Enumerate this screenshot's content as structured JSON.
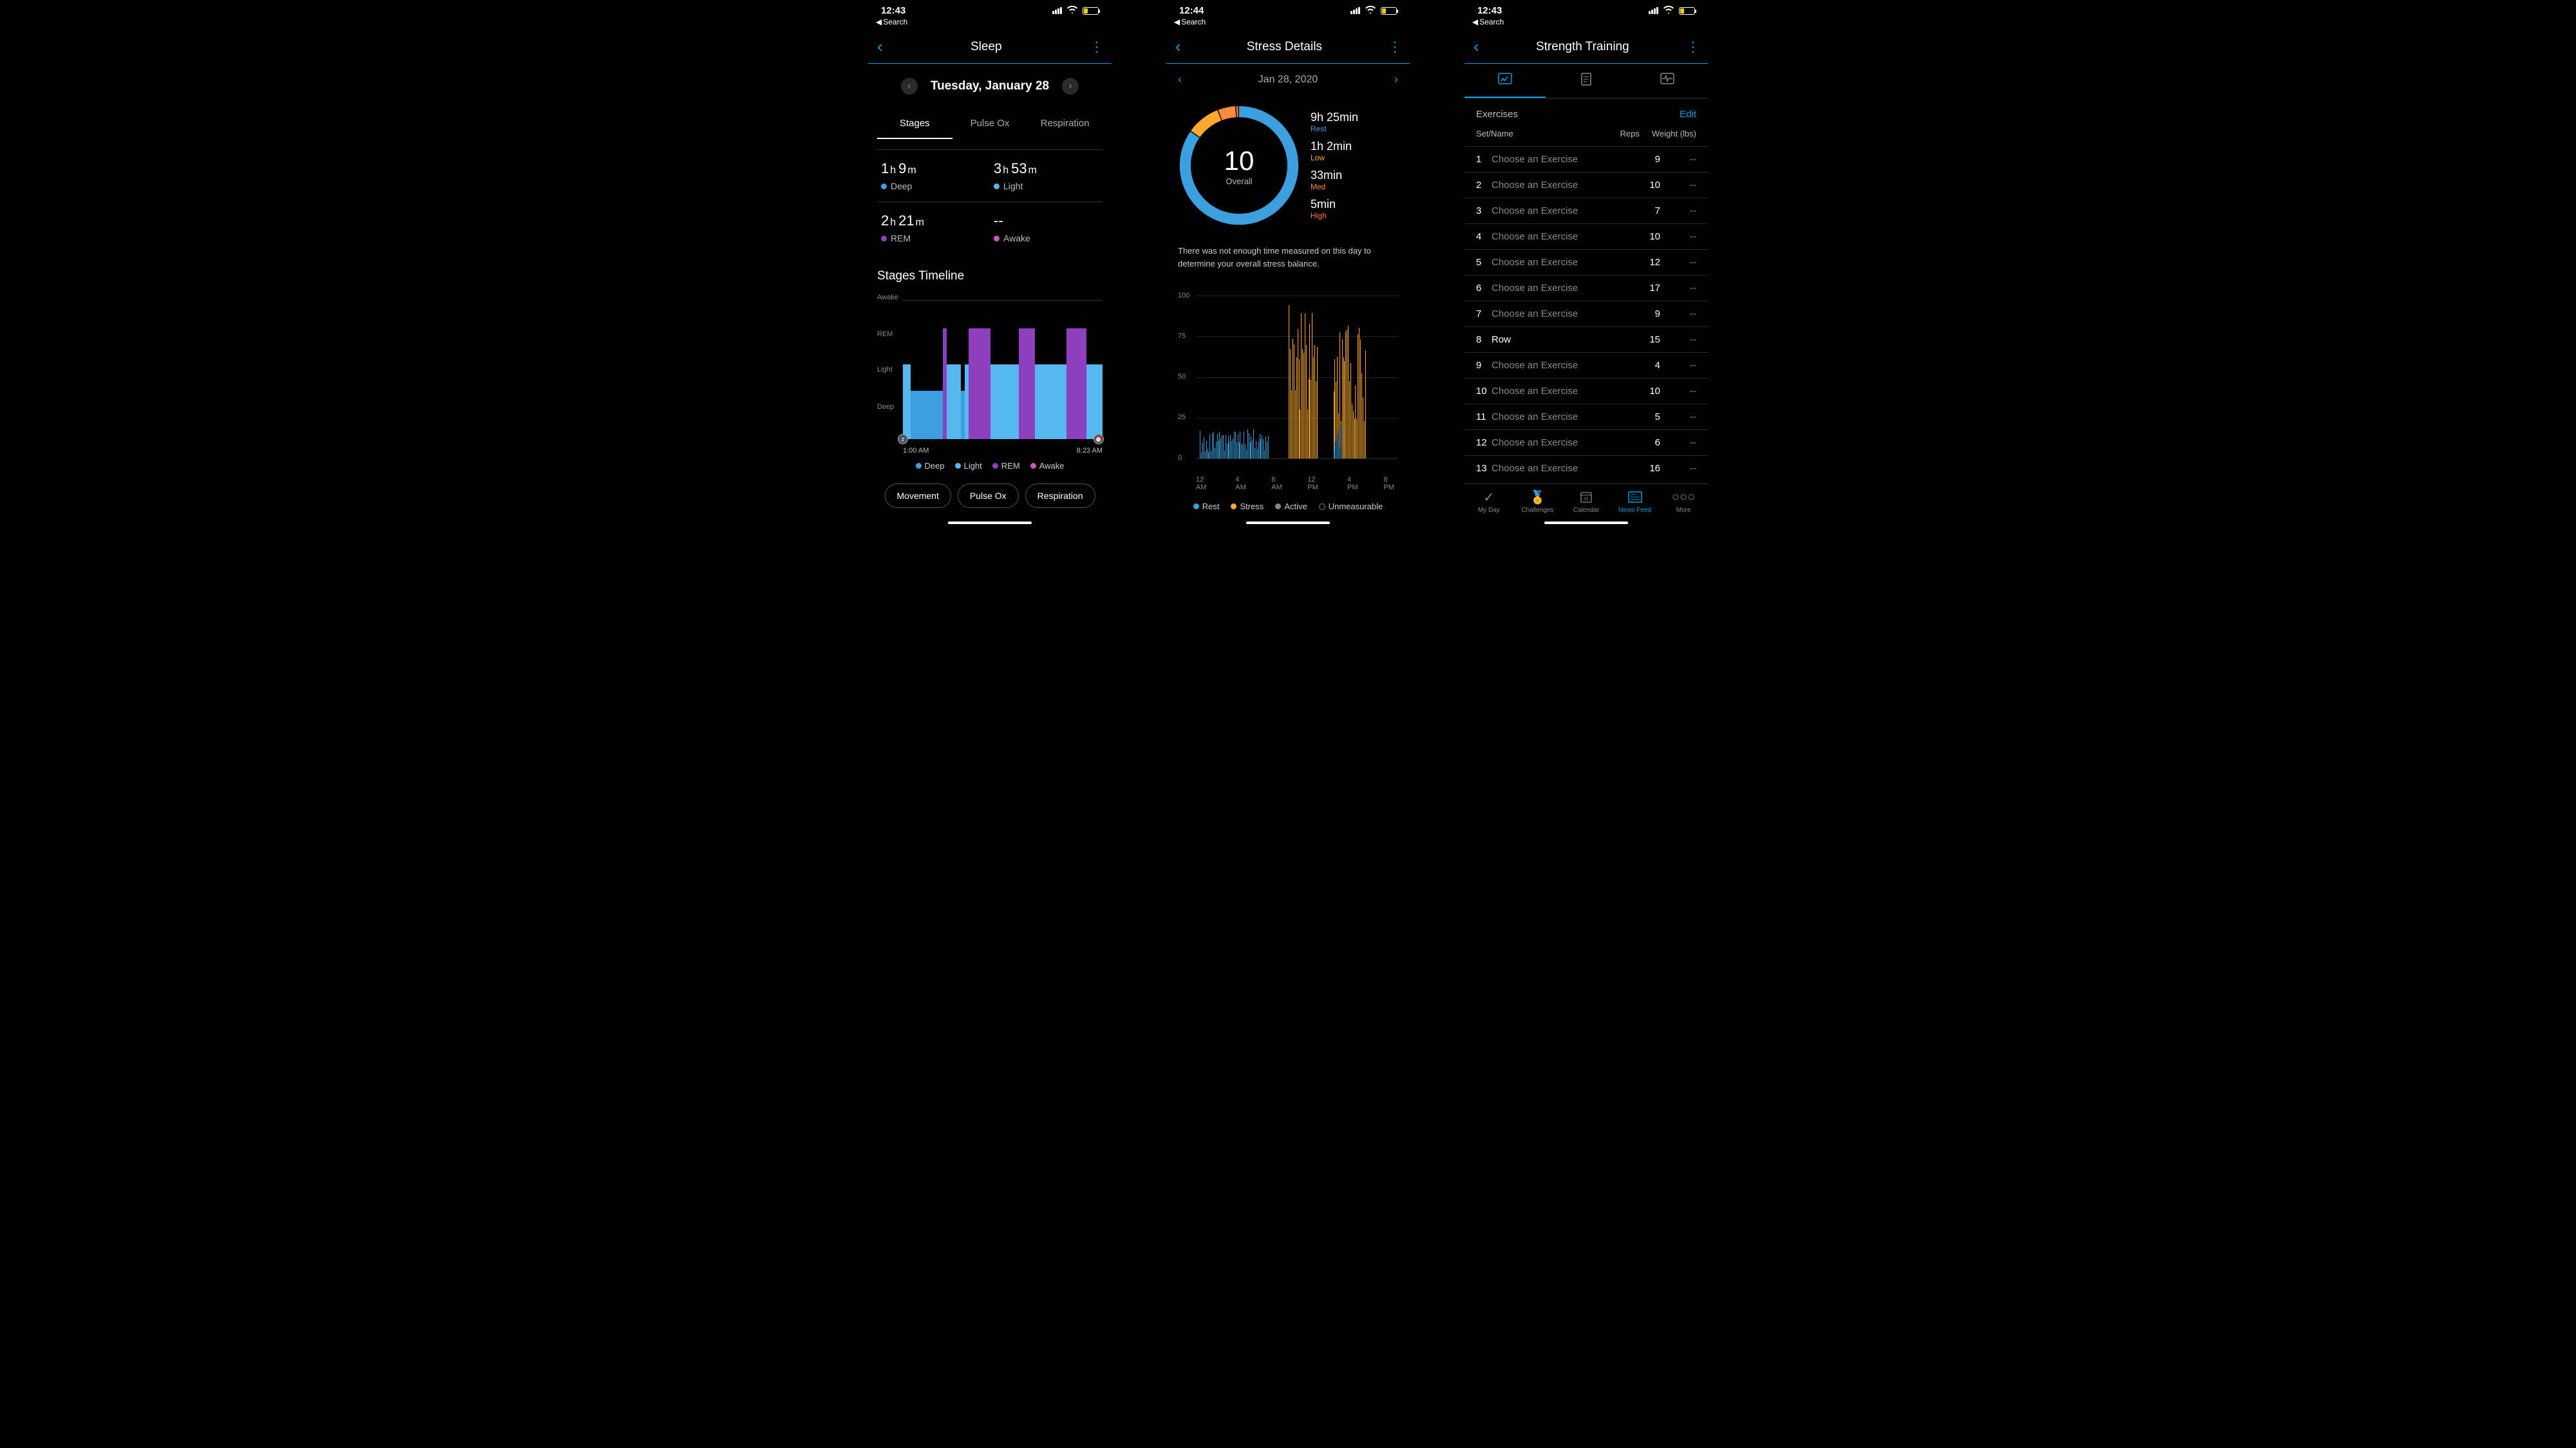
{
  "status": {
    "time1": "12:43",
    "time2": "12:44",
    "time3": "12:43",
    "breadcrumb": "Search"
  },
  "screen1": {
    "title": "Sleep",
    "date": "Tuesday, January 28",
    "tabs": {
      "stages": "Stages",
      "pulseox": "Pulse Ox",
      "respiration": "Respiration"
    },
    "stages": {
      "deep_h": "1",
      "deep_m": "9",
      "deep_label": "Deep",
      "light_h": "3",
      "light_m": "53",
      "light_label": "Light",
      "rem_h": "2",
      "rem_m": "21",
      "rem_label": "REM",
      "awake_val": "--",
      "awake_label": "Awake"
    },
    "timeline_title": "Stages Timeline",
    "y": {
      "awake": "Awake",
      "rem": "REM",
      "light": "Light",
      "deep": "Deep"
    },
    "x_start": "1:00 AM",
    "x_end": "8:23 AM",
    "legend": {
      "deep": "Deep",
      "light": "Light",
      "rem": "REM",
      "awake": "Awake"
    },
    "chips": {
      "movement": "Movement",
      "pulseox": "Pulse Ox",
      "respiration": "Respiration"
    }
  },
  "screen2": {
    "title": "Stress Details",
    "date": "Jan 28, 2020",
    "overall_value": "10",
    "overall_label": "Overall",
    "breakdown": {
      "rest_v": "9h 25min",
      "rest_l": "Rest",
      "low_v": "1h 2min",
      "low_l": "Low",
      "med_v": "33min",
      "med_l": "Med",
      "high_v": "5min",
      "high_l": "High"
    },
    "note": "There was not enough time measured on this day to determine your overall stress balance.",
    "y": {
      "y100": "100",
      "y75": "75",
      "y50": "50",
      "y25": "25",
      "y0": "0"
    },
    "x": {
      "x0": "12 AM",
      "x1": "4 AM",
      "x2": "8 AM",
      "x3": "12 PM",
      "x4": "4 PM",
      "x5": "8 PM"
    },
    "legend": {
      "rest": "Rest",
      "stress": "Stress",
      "active": "Active",
      "unm": "Unmeasurable"
    }
  },
  "screen3": {
    "title": "Strength Training",
    "exercises_label": "Exercises",
    "edit": "Edit",
    "col_sn": "Set/Name",
    "col_reps": "Reps",
    "col_weight": "Weight (lbs)",
    "placeholder": "Choose an Exercise",
    "rows": [
      {
        "n": "1",
        "name": "Choose an Exercise",
        "reps": "9",
        "w": "--",
        "has": false
      },
      {
        "n": "2",
        "name": "Choose an Exercise",
        "reps": "10",
        "w": "--",
        "has": false
      },
      {
        "n": "3",
        "name": "Choose an Exercise",
        "reps": "7",
        "w": "--",
        "has": false
      },
      {
        "n": "4",
        "name": "Choose an Exercise",
        "reps": "10",
        "w": "--",
        "has": false
      },
      {
        "n": "5",
        "name": "Choose an Exercise",
        "reps": "12",
        "w": "--",
        "has": false
      },
      {
        "n": "6",
        "name": "Choose an Exercise",
        "reps": "17",
        "w": "--",
        "has": false
      },
      {
        "n": "7",
        "name": "Choose an Exercise",
        "reps": "9",
        "w": "--",
        "has": false
      },
      {
        "n": "8",
        "name": "Row",
        "reps": "15",
        "w": "--",
        "has": true
      },
      {
        "n": "9",
        "name": "Choose an Exercise",
        "reps": "4",
        "w": "--",
        "has": false
      },
      {
        "n": "10",
        "name": "Choose an Exercise",
        "reps": "10",
        "w": "--",
        "has": false
      },
      {
        "n": "11",
        "name": "Choose an Exercise",
        "reps": "5",
        "w": "--",
        "has": false
      },
      {
        "n": "12",
        "name": "Choose an Exercise",
        "reps": "6",
        "w": "--",
        "has": false
      },
      {
        "n": "13",
        "name": "Choose an Exercise",
        "reps": "16",
        "w": "--",
        "has": false
      }
    ],
    "nav": {
      "myday": "My Day",
      "challenges": "Challenges",
      "calendar": "Calendar",
      "newsfeed": "News Feed",
      "more": "More"
    }
  },
  "colors": {
    "accent": "#00a0e4",
    "deep": "#3aa0de",
    "light": "#55b9f0",
    "rem": "#8e3fbf",
    "awake": "#d652c3",
    "stress": "#ffa92e"
  },
  "chart_data": [
    {
      "type": "bar",
      "title": "Stages Timeline",
      "ylabel": "",
      "xlabel": "",
      "x_start": "1:00 AM",
      "x_end": "8:23 AM",
      "y_categories": [
        "Deep",
        "Light",
        "REM",
        "Awake"
      ],
      "segments": [
        {
          "start_pct": 0,
          "end_pct": 4,
          "stage": "Light"
        },
        {
          "start_pct": 4,
          "end_pct": 20,
          "stage": "Deep"
        },
        {
          "start_pct": 20,
          "end_pct": 22,
          "stage": "REM"
        },
        {
          "start_pct": 22,
          "end_pct": 29,
          "stage": "Light"
        },
        {
          "start_pct": 29,
          "end_pct": 31,
          "stage": "Deep"
        },
        {
          "start_pct": 31,
          "end_pct": 33,
          "stage": "Light"
        },
        {
          "start_pct": 33,
          "end_pct": 44,
          "stage": "REM"
        },
        {
          "start_pct": 44,
          "end_pct": 58,
          "stage": "Light"
        },
        {
          "start_pct": 58,
          "end_pct": 66,
          "stage": "REM"
        },
        {
          "start_pct": 66,
          "end_pct": 82,
          "stage": "Light"
        },
        {
          "start_pct": 82,
          "end_pct": 92,
          "stage": "REM"
        },
        {
          "start_pct": 92,
          "end_pct": 100,
          "stage": "Light"
        }
      ]
    },
    {
      "type": "area",
      "title": "Stress",
      "ylim": [
        0,
        100
      ],
      "xlabel": "",
      "ylabel": "",
      "x_categories": [
        "12 AM",
        "4 AM",
        "8 AM",
        "12 PM",
        "4 PM",
        "8 PM"
      ],
      "regions": [
        {
          "x_start_pct": 2,
          "x_end_pct": 36,
          "kind": "rest",
          "peak": 18
        },
        {
          "x_start_pct": 46,
          "x_end_pct": 60,
          "kind": "stress",
          "peak": 95
        },
        {
          "x_start_pct": 68,
          "x_end_pct": 84,
          "kind": "stress",
          "peak": 88
        },
        {
          "x_start_pct": 68,
          "x_end_pct": 72,
          "kind": "rest",
          "peak": 22
        }
      ]
    },
    {
      "type": "pie",
      "title": "Stress Overall",
      "series": [
        {
          "name": "Rest",
          "value": 565,
          "color": "#3aa0de"
        },
        {
          "name": "Low",
          "value": 62,
          "color": "#ffa92e"
        },
        {
          "name": "Med",
          "value": 33,
          "color": "#ff8c3a"
        },
        {
          "name": "High",
          "value": 5,
          "color": "#ff7a3a"
        }
      ],
      "overall": 10
    }
  ]
}
